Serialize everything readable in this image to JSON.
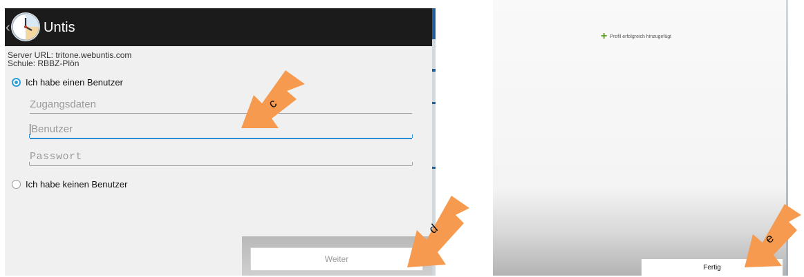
{
  "left_panel": {
    "app_title": "Untis",
    "server_url": "Server URL: tritone.webuntis.com",
    "school": "Schule: RBBZ-Plön",
    "radio_has_user": "Ich habe einen Benutzer",
    "radio_no_user": "Ich habe keinen Benutzer",
    "credentials_placeholder": "Zugangsdaten",
    "user_placeholder": "Benutzer",
    "password_placeholder": "Passwort",
    "next_button": "Weiter"
  },
  "right_panel": {
    "success_message": "Profil erfolgreich hinzugefügt",
    "done_button": "Fertig"
  },
  "annotations": [
    "c",
    "d",
    "e"
  ],
  "icons": {
    "app": "clock-icon",
    "back": "chevron-left-icon",
    "success": "plus-icon"
  },
  "colors": {
    "accent": "#2aa0d6",
    "arrow": "#f59a4e",
    "action_bar": "#1b1b1b",
    "success": "#5aa51d"
  }
}
